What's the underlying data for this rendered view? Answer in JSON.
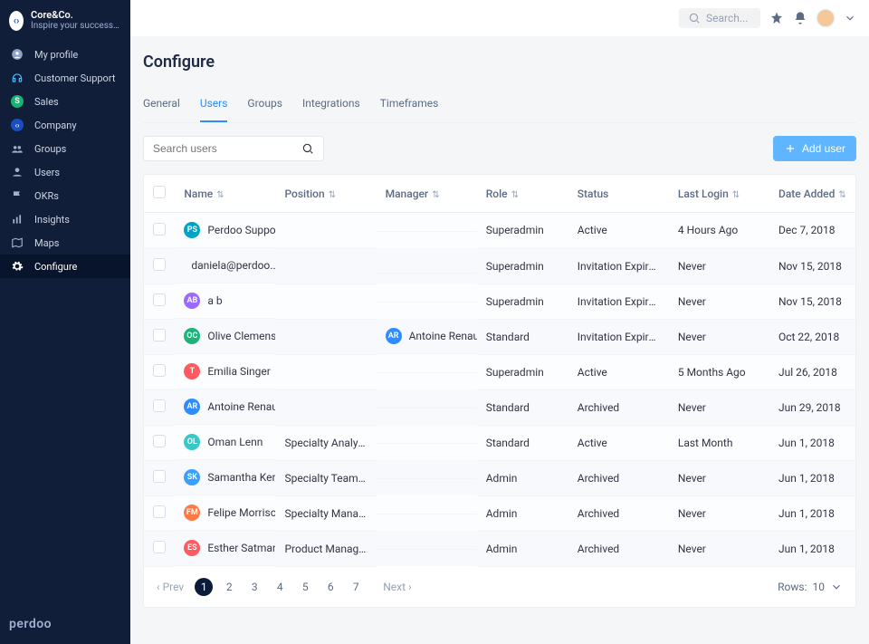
{
  "brand": {
    "title": "Core&Co.",
    "subtitle": "Inspire your success ..."
  },
  "topbar": {
    "search_placeholder": "Search..."
  },
  "sidebar": {
    "items": [
      {
        "label": "My profile"
      },
      {
        "label": "Customer Support"
      },
      {
        "label": "Sales"
      },
      {
        "label": "Company"
      },
      {
        "label": "Groups"
      },
      {
        "label": "Users"
      },
      {
        "label": "OKRs"
      },
      {
        "label": "Insights"
      },
      {
        "label": "Maps"
      },
      {
        "label": "Configure"
      }
    ],
    "footer": "perdoo"
  },
  "page": {
    "title": "Configure"
  },
  "tabs": [
    {
      "label": "General"
    },
    {
      "label": "Users"
    },
    {
      "label": "Groups"
    },
    {
      "label": "Integrations"
    },
    {
      "label": "Timeframes"
    }
  ],
  "toolbar": {
    "search_placeholder": "Search users",
    "add_user_label": "Add user"
  },
  "table": {
    "headers": {
      "name": "Name",
      "position": "Position",
      "manager": "Manager",
      "role": "Role",
      "status": "Status",
      "last_login": "Last Login",
      "date_added": "Date Added"
    },
    "rows": [
      {
        "initials": "PS",
        "color": "#00a3c4",
        "name": "Perdoo Support",
        "position": "",
        "manager": "",
        "role": "Superadmin",
        "status": "Active",
        "last_login": "4 Hours Ago",
        "date_added": "Dec 7, 2018"
      },
      {
        "initials": "",
        "photo": true,
        "color": "#c3c9d3",
        "name": "daniela@perdoo....",
        "position": "",
        "manager": "",
        "role": "Superadmin",
        "status": "Invitation Expired",
        "last_login": "Never",
        "date_added": "Nov 15, 2018"
      },
      {
        "initials": "AB",
        "color": "#9b6bff",
        "name": "a b",
        "position": "",
        "manager": "",
        "role": "Superadmin",
        "status": "Invitation Expired",
        "last_login": "Never",
        "date_added": "Nov 15, 2018"
      },
      {
        "initials": "OC",
        "color": "#1fb27a",
        "name": "Olive Clemens",
        "position": "",
        "manager": "Antoine Renault",
        "mgr_initials": "AR",
        "mgr_color": "#2d8cff",
        "role": "Standard",
        "status": "Invitation Expired",
        "last_login": "Never",
        "date_added": "Oct 22, 2018"
      },
      {
        "initials": "T",
        "color": "#ff5a5f",
        "name": "Emilia Singer",
        "position": "",
        "manager": "",
        "role": "Superadmin",
        "status": "Active",
        "last_login": "5 Months Ago",
        "date_added": "Jul 26, 2018"
      },
      {
        "initials": "AR",
        "color": "#2d8cff",
        "name": "Antoine Renault",
        "position": "",
        "manager": "",
        "role": "Standard",
        "status": "Archived",
        "last_login": "Never",
        "date_added": "Jun 29, 2018"
      },
      {
        "initials": "OL",
        "color": "#37c9c9",
        "name": "Oman Lenn",
        "position": "Specialty Analyst",
        "manager": "",
        "role": "Standard",
        "status": "Active",
        "last_login": "Last Month",
        "date_added": "Jun 1, 2018"
      },
      {
        "initials": "SK",
        "color": "#3aa0ff",
        "name": "Samantha Kerr",
        "position": "Specialty Team Lead",
        "manager": "",
        "role": "Admin",
        "status": "Archived",
        "last_login": "Never",
        "date_added": "Jun 1, 2018"
      },
      {
        "initials": "FM",
        "color": "#ff7a45",
        "name": "Felipe Morrison",
        "position": "Specialty Manager",
        "manager": "",
        "role": "Admin",
        "status": "Archived",
        "last_login": "Never",
        "date_added": "Jun 1, 2018"
      },
      {
        "initials": "ES",
        "color": "#ff5a5f",
        "name": "Esther Satman",
        "position": "Product Manager",
        "manager": "",
        "role": "Admin",
        "status": "Archived",
        "last_login": "Never",
        "date_added": "Jun 1, 2018"
      }
    ]
  },
  "pager": {
    "prev": "Prev",
    "next": "Next",
    "pages": [
      "1",
      "2",
      "3",
      "4",
      "5",
      "6",
      "7"
    ],
    "rows_label": "Rows:",
    "rows_value": "10"
  }
}
